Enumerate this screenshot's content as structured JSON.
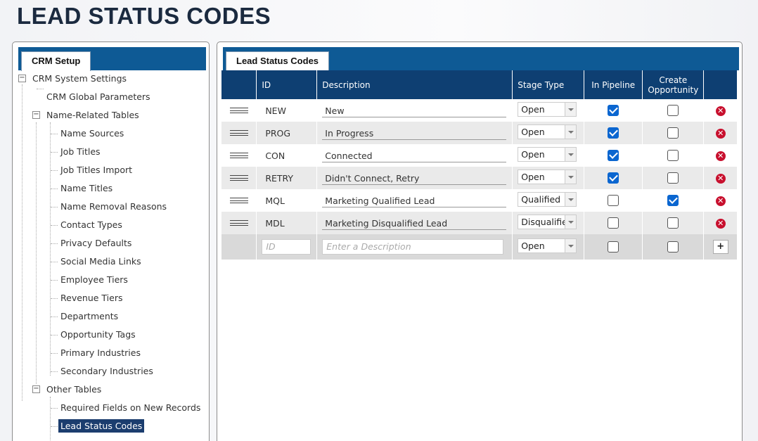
{
  "page": {
    "title": "LEAD STATUS CODES"
  },
  "sidebar": {
    "tab_label": "CRM Setup",
    "items": [
      {
        "label": "CRM System Settings"
      },
      {
        "label": "CRM Global Parameters"
      },
      {
        "label": "Name-Related Tables"
      },
      {
        "label": "Name Sources"
      },
      {
        "label": "Job Titles"
      },
      {
        "label": "Job Titles Import"
      },
      {
        "label": "Name Titles"
      },
      {
        "label": "Name Removal Reasons"
      },
      {
        "label": "Contact Types"
      },
      {
        "label": "Privacy Defaults"
      },
      {
        "label": "Social Media Links"
      },
      {
        "label": "Employee Tiers"
      },
      {
        "label": "Revenue Tiers"
      },
      {
        "label": "Departments"
      },
      {
        "label": "Opportunity Tags"
      },
      {
        "label": "Primary Industries"
      },
      {
        "label": "Secondary Industries"
      },
      {
        "label": "Other Tables"
      },
      {
        "label": "Required Fields on New Records"
      },
      {
        "label": "Lead Status Codes"
      }
    ],
    "expander_collapse_glyph": "−"
  },
  "main": {
    "tab_label": "Lead Status Codes",
    "columns": {
      "id": "ID",
      "description": "Description",
      "stage_type": "Stage Type",
      "in_pipeline": "In Pipeline",
      "create_opportunity": "Create Opportunity"
    },
    "rows": [
      {
        "id": "NEW",
        "description": "New",
        "stage": "Open",
        "in_pipeline": true,
        "create_opp": false
      },
      {
        "id": "PROG",
        "description": "In Progress",
        "stage": "Open",
        "in_pipeline": true,
        "create_opp": false
      },
      {
        "id": "CON",
        "description": "Connected",
        "stage": "Open",
        "in_pipeline": true,
        "create_opp": false
      },
      {
        "id": "RETRY",
        "description": "Didn't Connect, Retry",
        "stage": "Open",
        "in_pipeline": true,
        "create_opp": false
      },
      {
        "id": "MQL",
        "description": "Marketing Qualified Lead",
        "stage": "Qualified",
        "in_pipeline": false,
        "create_opp": true
      },
      {
        "id": "MDL",
        "description": "Marketing Disqualified Lead",
        "stage": "Disqualifie",
        "in_pipeline": false,
        "create_opp": false
      }
    ],
    "new_row": {
      "id_placeholder": "ID",
      "description_placeholder": "Enter a Description",
      "stage": "Open",
      "add_label": "+"
    },
    "delete_glyph": "✕"
  },
  "colors": {
    "header_blue": "#0e3f72",
    "bar_blue": "#0e5a95",
    "checkbox_blue": "#0b66d0",
    "delete_red": "#c8102e"
  }
}
